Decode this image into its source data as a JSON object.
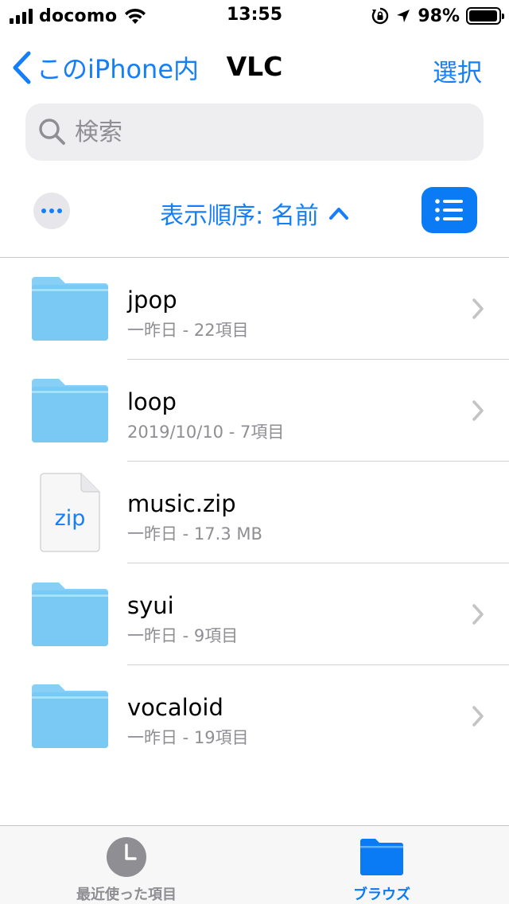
{
  "status_bar": {
    "carrier": "docomo",
    "time": "13:55",
    "battery_percent": "98%",
    "battery_level": 0.98
  },
  "nav": {
    "back_label": "このiPhone内",
    "title": "VLC",
    "select_label": "選択"
  },
  "search": {
    "placeholder": "検索"
  },
  "toolbar": {
    "sort_label": "表示順序: 名前"
  },
  "files": [
    {
      "name": "jpop",
      "meta": "一昨日 - 22項目",
      "type": "folder"
    },
    {
      "name": "loop",
      "meta": "2019/10/10 - 7項目",
      "type": "folder"
    },
    {
      "name": "music.zip",
      "meta": "一昨日 - 17.3 MB",
      "type": "zip",
      "icon_label": "zip"
    },
    {
      "name": "syui",
      "meta": "一昨日 - 9項目",
      "type": "folder"
    },
    {
      "name": "vocaloid",
      "meta": "一昨日 - 19項目",
      "type": "folder"
    }
  ],
  "tab_bar": {
    "recent_label": "最近使った項目",
    "browse_label": "ブラウズ"
  },
  "colors": {
    "accent": "#147efb",
    "folder": "#7dc8f5",
    "secondary_text": "#8e8e93"
  },
  "icons": {
    "folder": "folder-icon",
    "zip": "zip-file-icon",
    "chevron": "chevron-right-icon",
    "search": "search-icon",
    "back": "chevron-left-icon",
    "more": "ellipsis-icon",
    "list": "list-view-icon",
    "recent": "clock-icon",
    "browse": "folder-icon"
  }
}
